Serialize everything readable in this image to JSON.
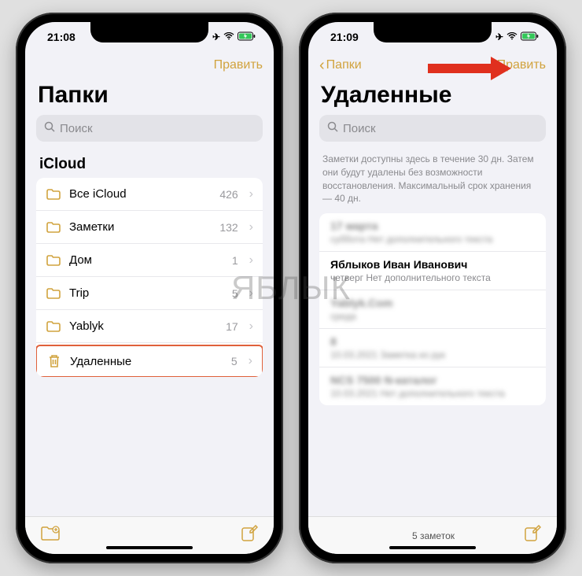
{
  "watermark": "ЯБЛЫК",
  "left": {
    "time": "21:08",
    "edit": "Править",
    "title": "Папки",
    "search_placeholder": "Поиск",
    "section": "iCloud",
    "folders": [
      {
        "label": "Все iCloud",
        "count": "426",
        "icon": "folder"
      },
      {
        "label": "Заметки",
        "count": "132",
        "icon": "folder"
      },
      {
        "label": "Дом",
        "count": "1",
        "icon": "folder"
      },
      {
        "label": "Trip",
        "count": "5",
        "icon": "folder"
      },
      {
        "label": "Yablyk",
        "count": "17",
        "icon": "folder"
      },
      {
        "label": "Удаленные",
        "count": "5",
        "icon": "trash",
        "highlight": true
      }
    ]
  },
  "right": {
    "time": "21:09",
    "back": "Папки",
    "edit": "Править",
    "title": "Удаленные",
    "search_placeholder": "Поиск",
    "hint": "Заметки доступны здесь в течение 30 дн. Затем они будут удалены без возможности восстановления. Максимальный срок хранения — 40 дн.",
    "notes": [
      {
        "title": "17 марта",
        "subtitle": "суббота Нет дополнительного текста",
        "blur": true
      },
      {
        "title": "Яблыков Иван Иванович",
        "subtitle": "четверг  Нет дополнительного текста",
        "blur": false
      },
      {
        "title": "Yablyk.Com",
        "subtitle": "среда",
        "blur": true
      },
      {
        "title": "8",
        "subtitle": "10.03.2021 Заметка из рук",
        "blur": true
      },
      {
        "title": "NCS 7500 N-каталог",
        "subtitle": "10.03.2021 Нет дополнительного текста",
        "blur": true
      }
    ],
    "footer_count": "5 заметок"
  }
}
